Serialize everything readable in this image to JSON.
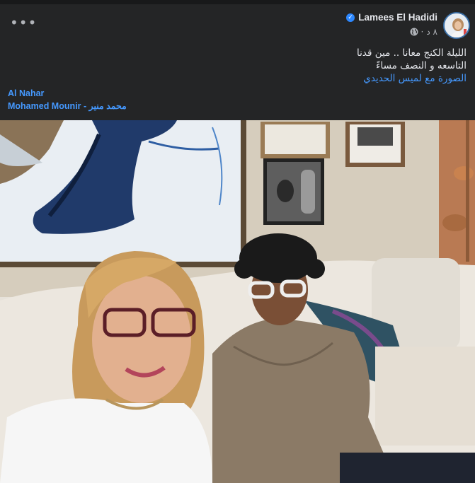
{
  "post": {
    "author": "Lamees El Hadidi",
    "time": "٨ د",
    "caption_lines": [
      "الليلة الكنج معانا .. مين قدنا",
      "التاسعه و النصف مساءً"
    ],
    "with_line": "الصورة مع لميس الحديدي",
    "tags": [
      "Al Nahar",
      "Mohamed Mounir - محمد منير"
    ]
  },
  "colors": {
    "background": "#242526",
    "link": "#4599ff",
    "text": "#e4e6eb",
    "muted": "#b0b3b8",
    "verified": "#2d88ff"
  },
  "icons": [
    "more-options-icon",
    "verified-badge-icon",
    "globe-icon",
    "avatar"
  ]
}
